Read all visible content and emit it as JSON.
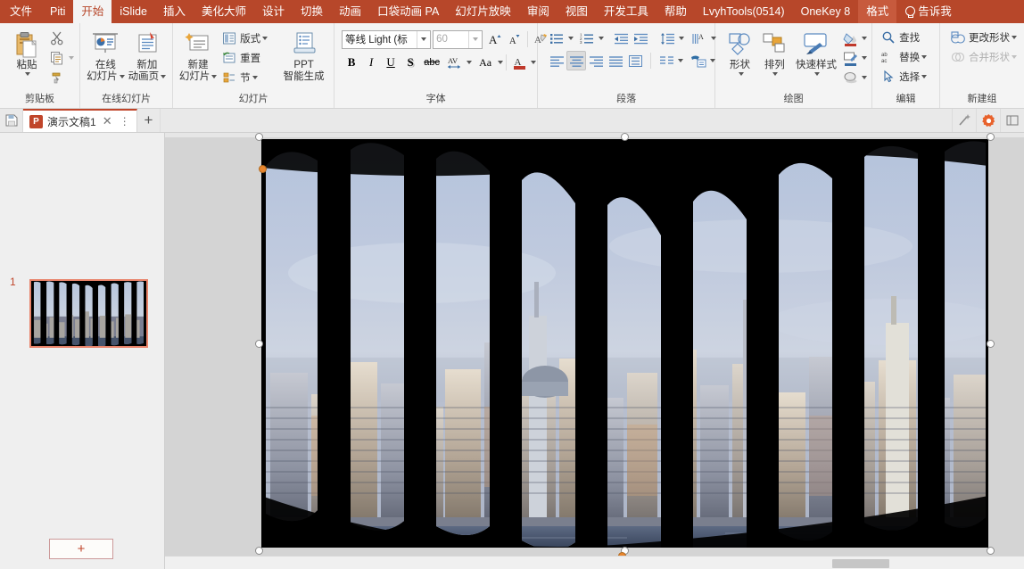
{
  "menubar": {
    "tabs": [
      {
        "label": "文件",
        "state": "file"
      },
      {
        "label": "Piti",
        "state": "normal"
      },
      {
        "label": "开始",
        "state": "active"
      },
      {
        "label": "iSlide",
        "state": "normal"
      },
      {
        "label": "插入",
        "state": "normal"
      },
      {
        "label": "美化大师",
        "state": "normal"
      },
      {
        "label": "设计",
        "state": "normal"
      },
      {
        "label": "切换",
        "state": "normal"
      },
      {
        "label": "动画",
        "state": "normal"
      },
      {
        "label": "口袋动画 PA",
        "state": "normal"
      },
      {
        "label": "幻灯片放映",
        "state": "normal"
      },
      {
        "label": "审阅",
        "state": "normal"
      },
      {
        "label": "视图",
        "state": "normal"
      },
      {
        "label": "开发工具",
        "state": "normal"
      },
      {
        "label": "帮助",
        "state": "normal"
      },
      {
        "label": "LvyhTools(0514)",
        "state": "normal"
      },
      {
        "label": "OneKey 8",
        "state": "normal"
      },
      {
        "label": "格式",
        "state": "contextual"
      }
    ],
    "tellme": {
      "label": "告诉我",
      "icon": "lightbulb-icon"
    },
    "accent": "#b7472a"
  },
  "ribbon": {
    "groups": [
      {
        "name": "clipboard",
        "label": "剪贴板",
        "has_dialog_launcher": true,
        "items": [
          {
            "name": "paste",
            "label_line1": "粘贴",
            "label_line2": "",
            "icon": "paste-icon",
            "has_caret": true
          },
          {
            "name": "cut",
            "label": "剪切",
            "icon": "scissors-icon"
          },
          {
            "name": "copy",
            "label": "复制",
            "icon": "copy-icon",
            "has_caret": true
          },
          {
            "name": "format-painter",
            "label": "格式刷",
            "icon": "format-painter-icon"
          }
        ]
      },
      {
        "name": "online-slides",
        "label": "在线幻灯片",
        "has_dialog_launcher": false,
        "items": [
          {
            "name": "online-slide",
            "label_line1": "在线",
            "label_line2": "幻灯片",
            "icon": "online-slide-icon",
            "has_caret": true
          },
          {
            "name": "add-animation-page",
            "label_line1": "新加",
            "label_line2": "动画页",
            "icon": "animation-page-icon",
            "has_caret": true
          }
        ]
      },
      {
        "name": "slides",
        "label": "幻灯片",
        "has_dialog_launcher": false,
        "items": [
          {
            "name": "new-slide",
            "label_line1": "新建",
            "label_line2": "幻灯片",
            "icon": "new-slide-icon",
            "has_caret": true
          },
          {
            "name": "layout",
            "label": "版式",
            "icon": "layout-icon",
            "has_caret": true
          },
          {
            "name": "reset",
            "label": "重置",
            "icon": "reset-icon"
          },
          {
            "name": "section",
            "label": "节",
            "icon": "section-icon",
            "has_caret": true
          },
          {
            "name": "ppt-smart-generate",
            "label_line1": "PPT",
            "label_line2": "智能生成",
            "icon": "ppt-generate-icon"
          }
        ]
      },
      {
        "name": "font",
        "label": "字体",
        "has_dialog_launcher": true,
        "font_name": "等线 Light (标",
        "font_size": "60",
        "items": [
          {
            "name": "grow-font",
            "label": "增大字号",
            "icon": "grow-font-icon"
          },
          {
            "name": "shrink-font",
            "label": "减小字号",
            "icon": "shrink-font-icon"
          },
          {
            "name": "clear-formatting",
            "label": "清除所有格式",
            "icon": "clear-format-icon"
          },
          {
            "name": "bold",
            "label": "B",
            "icon": "bold-icon"
          },
          {
            "name": "italic",
            "label": "I",
            "icon": "italic-icon"
          },
          {
            "name": "underline",
            "label": "U",
            "icon": "underline-icon"
          },
          {
            "name": "shadow",
            "label": "S",
            "icon": "text-shadow-icon"
          },
          {
            "name": "strikethrough",
            "label": "abc",
            "icon": "strikethrough-icon"
          },
          {
            "name": "character-spacing",
            "label": "AV",
            "icon": "char-spacing-icon",
            "has_caret": true
          },
          {
            "name": "change-case",
            "label": "Aa",
            "icon": "change-case-icon",
            "has_caret": true
          },
          {
            "name": "font-color",
            "label": "A",
            "icon": "font-color-icon",
            "has_caret": true,
            "color": "#c0392b"
          }
        ]
      },
      {
        "name": "paragraph",
        "label": "段落",
        "has_dialog_launcher": true,
        "items": [
          {
            "name": "bullets",
            "icon": "bullets-icon",
            "has_caret": true
          },
          {
            "name": "numbering",
            "icon": "numbering-icon",
            "has_caret": true
          },
          {
            "name": "decrease-indent",
            "icon": "decrease-indent-icon"
          },
          {
            "name": "increase-indent",
            "icon": "increase-indent-icon"
          },
          {
            "name": "line-spacing",
            "icon": "line-spacing-icon",
            "has_caret": true
          },
          {
            "name": "text-direction",
            "icon": "text-direction-icon",
            "has_caret": true
          },
          {
            "name": "align-left",
            "icon": "align-left-icon"
          },
          {
            "name": "align-center",
            "icon": "align-center-icon",
            "active": true
          },
          {
            "name": "align-right",
            "icon": "align-right-icon"
          },
          {
            "name": "justify",
            "icon": "justify-icon"
          },
          {
            "name": "distribute",
            "icon": "distribute-icon"
          },
          {
            "name": "columns",
            "icon": "columns-icon",
            "has_caret": true
          },
          {
            "name": "align-text",
            "icon": "align-text-icon",
            "has_caret": true
          },
          {
            "name": "convert-smartart",
            "icon": "smartart-icon",
            "has_caret": true
          }
        ]
      },
      {
        "name": "drawing",
        "label": "绘图",
        "has_dialog_launcher": true,
        "items": [
          {
            "name": "shapes",
            "label_line1": "形状",
            "icon": "shapes-icon",
            "has_caret": true
          },
          {
            "name": "arrange",
            "label_line1": "排列",
            "icon": "arrange-icon",
            "has_caret": true
          },
          {
            "name": "quick-styles",
            "label_line1": "快速样式",
            "icon": "quick-styles-icon",
            "has_caret": true
          },
          {
            "name": "shape-fill",
            "icon": "shape-fill-icon",
            "has_caret": true
          },
          {
            "name": "shape-outline",
            "icon": "shape-outline-icon",
            "has_caret": true
          },
          {
            "name": "shape-effects",
            "icon": "shape-effects-icon",
            "has_caret": true
          }
        ]
      },
      {
        "name": "editing",
        "label": "编辑",
        "has_dialog_launcher": false,
        "items": [
          {
            "name": "find",
            "label": "查找",
            "icon": "search-icon"
          },
          {
            "name": "replace",
            "label": "替换",
            "icon": "replace-icon",
            "has_caret": true
          },
          {
            "name": "select",
            "label": "选择",
            "icon": "select-icon",
            "has_caret": true
          }
        ]
      },
      {
        "name": "new-group",
        "label": "新建组",
        "has_dialog_launcher": false,
        "items": [
          {
            "name": "change-shape",
            "label": "更改形状",
            "icon": "change-shape-icon",
            "has_caret": true,
            "disabled": false
          },
          {
            "name": "merge-shapes",
            "label": "合并形状",
            "icon": "merge-shapes-icon",
            "has_caret": true,
            "disabled": true
          }
        ]
      }
    ]
  },
  "docbar": {
    "save_icon": "save-icon",
    "tab": {
      "title": "演示文稿1",
      "app_icon": "powerpoint-icon",
      "close_icon": "close-icon",
      "menu_icon": "more-icon"
    },
    "new_tab_icon": "plus-icon",
    "right_buttons": [
      {
        "name": "magic-wand-button",
        "icon": "magic-wand-icon"
      },
      {
        "name": "settings-button",
        "icon": "gear-icon",
        "color": "#e8622c"
      },
      {
        "name": "panel-button",
        "icon": "panel-icon"
      }
    ]
  },
  "thumbnail_pane": {
    "slides": [
      {
        "number": "1",
        "selected": true,
        "name": "slide-thumbnail-1"
      }
    ],
    "add_slide_label": "+",
    "selection_color": "#e8836a"
  },
  "editor": {
    "selected_object": "picture-blinds",
    "handles": [
      "top-left",
      "top-center",
      "top-right",
      "middle-left",
      "middle-right",
      "bottom-left",
      "bottom-center",
      "bottom-right"
    ],
    "rotation_handle_color": "#e8862f",
    "scroll": {
      "horizontal_position": "92%"
    }
  }
}
